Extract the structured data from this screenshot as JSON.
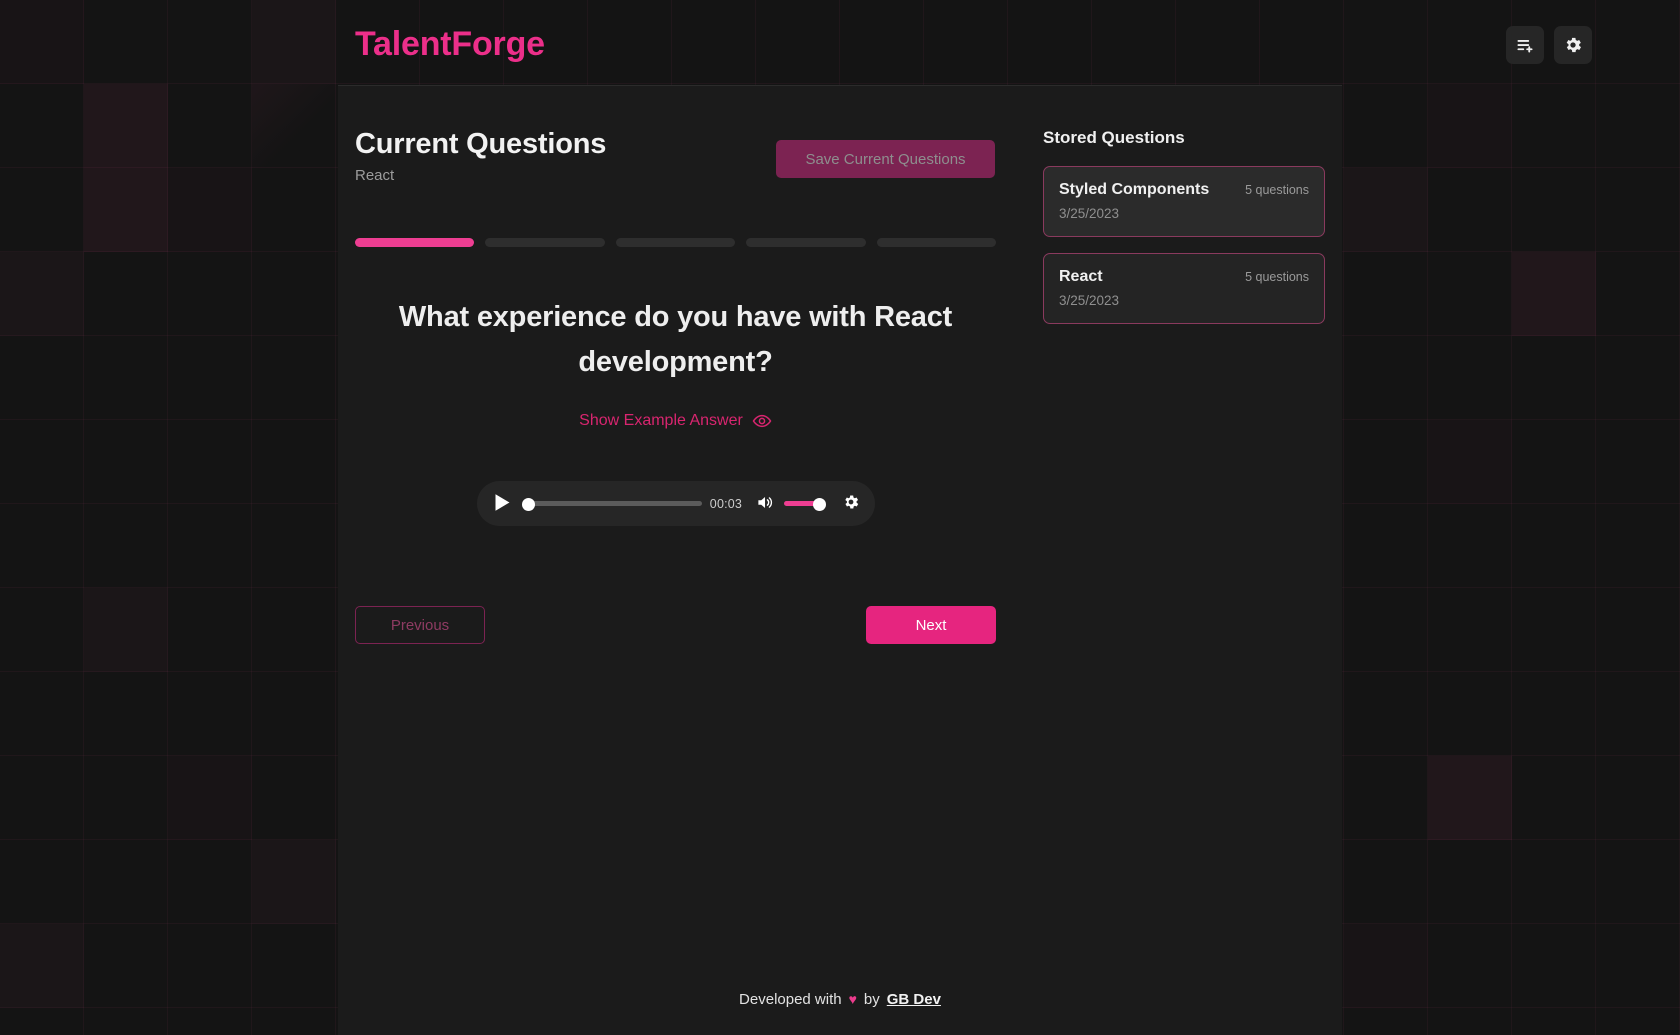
{
  "brand": {
    "name": "TalentForge",
    "color": "#ec2f8a"
  },
  "topbar": {
    "actions": [
      {
        "name": "playlist-add-icon",
        "label": "Add Questions"
      },
      {
        "name": "gear-icon",
        "label": "Settings"
      }
    ]
  },
  "header": {
    "title": "Current Questions",
    "subtitle": "React",
    "save_label": "Save Current Questions"
  },
  "progress": {
    "total": 5,
    "current": 1
  },
  "question": {
    "text": "What experience do you have with React development?",
    "example_answer_label": "Show Example Answer",
    "example_answer_icon": "eye-icon"
  },
  "audio": {
    "play_icon": "play-icon",
    "time": "00:03",
    "seek_percent": 0,
    "volume_percent": 100,
    "mute_icon": "volume-high-icon",
    "settings_icon": "gear-icon"
  },
  "nav": {
    "previous_label": "Previous",
    "next_label": "Next"
  },
  "stored": {
    "title": "Stored Questions",
    "items": [
      {
        "name": "Styled Components",
        "count": "5 questions",
        "date": "3/25/2023"
      },
      {
        "name": "React",
        "count": "5 questions",
        "date": "3/25/2023"
      }
    ]
  },
  "footer": {
    "prefix": "Developed with",
    "heart": "♥",
    "middle": "by",
    "author": "GB Dev"
  },
  "colors": {
    "accent": "#ec2f8a",
    "accent_solid": "#e6257f",
    "accent_muted": "#7c2352",
    "panel": "#1b1b1b",
    "page": "#141414",
    "card": "#242424"
  }
}
